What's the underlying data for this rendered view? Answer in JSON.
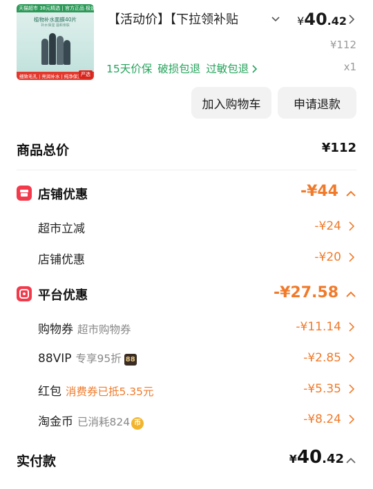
{
  "product": {
    "thumb": {
      "top_text": "天猫超市 38元精选 | 官方正品 极速送达",
      "title": "植物补水面膜40片",
      "subtitle": "补水保湿 温和亲肤",
      "bottom_text": "细致毛孔 | 亮润补水 | 纯净保湿",
      "badge": "严选"
    },
    "title": "【活动价】【下拉领补贴",
    "price_currency": "¥",
    "price_int": "40",
    "price_dec": ".42",
    "original_price": "¥112",
    "quantity": "x1",
    "guarantees": [
      "15天价保",
      "破损包退",
      "过敏包退"
    ],
    "buttons": {
      "cart": "加入购物车",
      "refund": "申请退款"
    }
  },
  "summary": {
    "total_label": "商品总价",
    "total_value": "¥112",
    "store": {
      "label": "店铺优惠",
      "value": "-¥44",
      "items": [
        {
          "label": "超市立减",
          "value": "-¥24"
        },
        {
          "label": "店铺优惠",
          "value": "-¥20"
        }
      ]
    },
    "platform": {
      "label": "平台优惠",
      "value": "-¥27.58",
      "items": [
        {
          "label": "购物券",
          "sub": "超市购物券",
          "value": "-¥11.14"
        },
        {
          "label": "88VIP",
          "sub": "专享95折",
          "badge": "88",
          "value": "-¥2.85"
        },
        {
          "label": "红包",
          "sub": "消费券已抵5.35元",
          "value": "-¥5.35"
        },
        {
          "label": "淘金币",
          "sub": "已消耗824",
          "badge": "币",
          "value": "-¥8.24"
        }
      ]
    },
    "pay": {
      "label": "实付款",
      "currency": "¥",
      "int": "40",
      "dec": ".42"
    }
  },
  "colors": {
    "accent_orange": "#f07a2a",
    "green": "#26a35c",
    "red_icon": "#f23a4b"
  },
  "icons": [
    "chevron-down-icon",
    "chevron-right-icon",
    "chevron-up-icon",
    "store-icon",
    "platform-icon",
    "vip-badge-icon",
    "coin-icon"
  ]
}
